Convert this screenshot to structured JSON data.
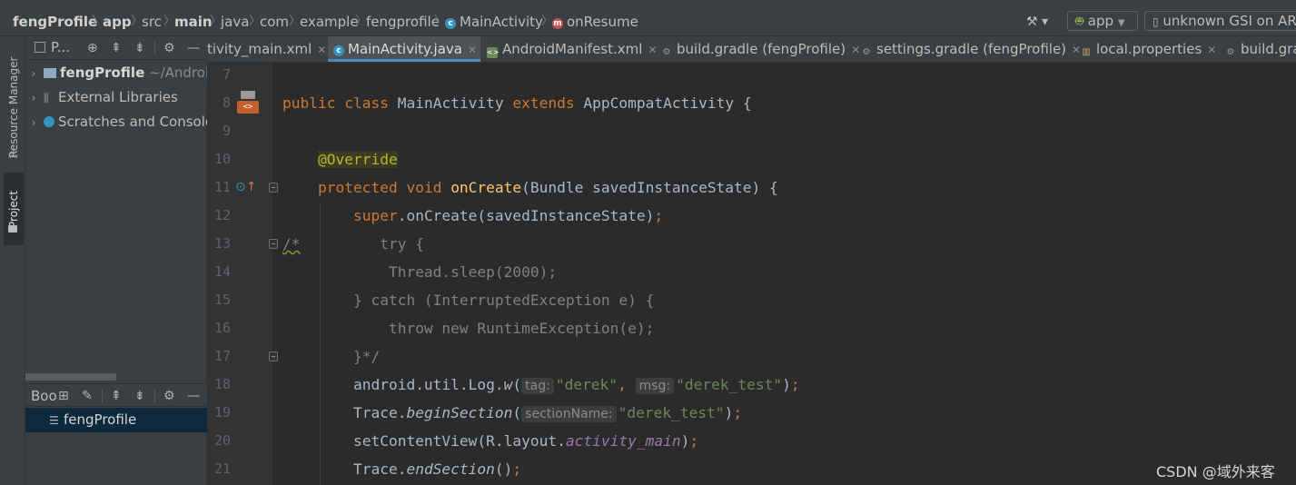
{
  "breadcrumb": {
    "items": [
      "fengProfile",
      "app",
      "src",
      "main",
      "java",
      "com",
      "example",
      "fengprofile",
      "MainActivity",
      "onResume"
    ]
  },
  "toolbar": {
    "run_config": "app",
    "device": "unknown GSI on ARM"
  },
  "left_strip": {
    "resource_manager": "Resource Manager",
    "project": "Project"
  },
  "project_panel": {
    "title": "P...",
    "tree": [
      {
        "label": "fengProfile",
        "suffix": " ~/Android"
      },
      {
        "label": "External Libraries"
      },
      {
        "label": "Scratches and Consoles"
      }
    ]
  },
  "bookmarks_panel": {
    "title": "Boo",
    "items": [
      "fengProfile"
    ]
  },
  "editor_tabs": [
    {
      "label": "tivity_main.xml",
      "icon": "xml-file-icon",
      "active": false
    },
    {
      "label": "MainActivity.java",
      "icon": "java-class-icon",
      "active": true
    },
    {
      "label": "AndroidManifest.xml",
      "icon": "xml-file-icon",
      "active": false
    },
    {
      "label": "build.gradle (fengProfile)",
      "icon": "gradle-icon",
      "active": false
    },
    {
      "label": "settings.gradle (fengProfile)",
      "icon": "gradle-icon",
      "active": false
    },
    {
      "label": "local.properties",
      "icon": "properties-icon",
      "active": false
    },
    {
      "label": "build.gra",
      "icon": "gradle-icon",
      "active": false
    }
  ],
  "code": {
    "line_numbers": [
      "7",
      "8",
      "9",
      "10",
      "11",
      "12",
      "13",
      "14",
      "15",
      "16",
      "17",
      "18",
      "19",
      "20",
      "21"
    ],
    "l8": {
      "public": "public",
      "class": "class",
      "name": "MainActivity",
      "extends": "extends",
      "parent": "AppCompatActivity",
      "brace": " {"
    },
    "l10": "@Override",
    "l11": {
      "protected": "protected",
      "void": "void",
      "name": "onCreate",
      "rest": "(Bundle savedInstanceState) {"
    },
    "l12": {
      "super": "super",
      "rest": ".onCreate(savedInstanceState)",
      "semi": ";"
    },
    "l13": {
      "comment_start": "/*",
      "text": "try {"
    },
    "l14": "Thread.sleep(2000);",
    "l15": "} catch (InterruptedException e) {",
    "l16": "throw new RuntimeException(e);",
    "l17": "}*/",
    "l18": {
      "pre": "android.util.Log.",
      "method": "w",
      "open": "(",
      "hint1": "tag:",
      "arg1": "\"derek\"",
      "comma": ", ",
      "hint2": "msg:",
      "arg2": "\"derek_test\"",
      "close": ")",
      "semi": ";"
    },
    "l19": {
      "pre": "Trace.",
      "method": "beginSection",
      "open": "(",
      "hint": "sectionName:",
      "arg": "\"derek_test\"",
      "close": ")",
      "semi": ";"
    },
    "l20": {
      "pre": "setContentView(R.layout.",
      "field": "activity_main",
      "close": ")",
      "semi": ";"
    },
    "l21": {
      "pre": "Trace.",
      "method": "endSection",
      "close": "()",
      "semi": ";"
    }
  },
  "watermark": "CSDN @域外来客"
}
